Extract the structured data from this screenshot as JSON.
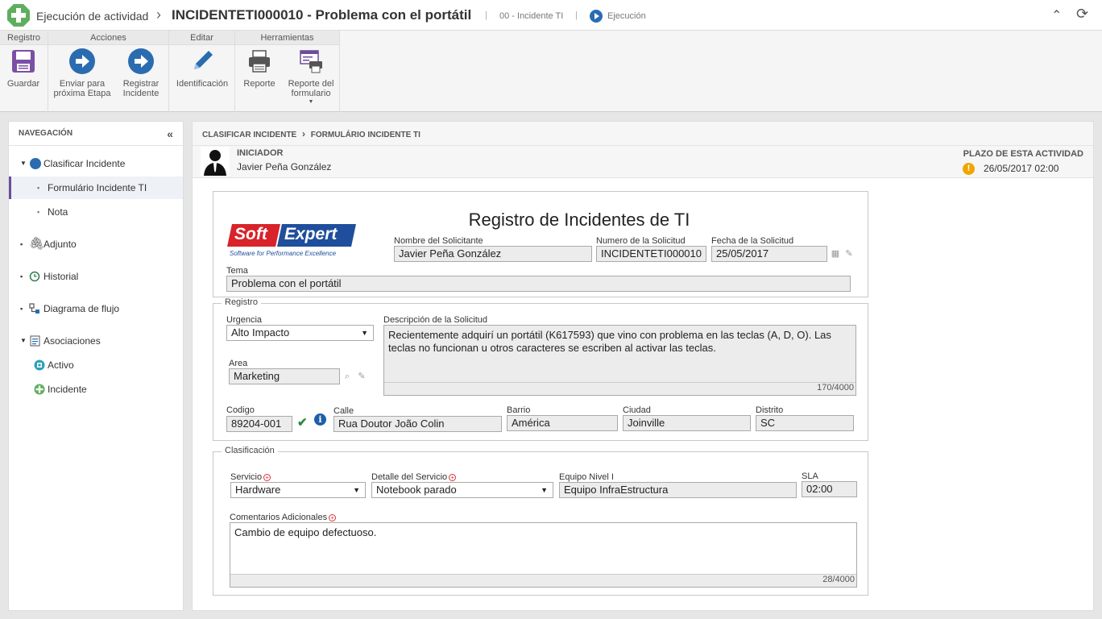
{
  "header": {
    "app_title": "Ejecución de actividad",
    "record_title": "INCIDENTETI000010 - Problema con el portátil",
    "process": "00 - Incidente TI",
    "status": "Ejecución"
  },
  "toolbar": {
    "groups": [
      "Registro",
      "Acciones",
      "Editar",
      "Herramientas"
    ],
    "save": "Guardar",
    "send_l1": "Enviar para",
    "send_l2": "próxima Etapa",
    "register_l1": "Registrar",
    "register_l2": "Incidente",
    "identification": "Identificación",
    "report": "Reporte",
    "form_report_l1": "Reporte del",
    "form_report_l2": "formulario"
  },
  "nav": {
    "title": "NAVEGACIÓN",
    "items": {
      "classify": "Clasificar Incidente",
      "form": "Formulário Incidente TI",
      "note": "Nota",
      "attachment": "Adjunto",
      "history": "Historial",
      "flow": "Diagrama de flujo",
      "associations": "Asociaciones",
      "asset": "Activo",
      "incident": "Incidente"
    }
  },
  "breadcrumb": {
    "step": "CLASIFICAR INCIDENTE",
    "form": "FORMULÁRIO INCIDENTE TI"
  },
  "initiator": {
    "label": "INICIADOR",
    "name": "Javier Peña González",
    "deadline_label": "PLAZO DE ESTA ACTIVIDAD",
    "deadline": "26/05/2017  02:00"
  },
  "form": {
    "title": "Registro de Incidentes de TI",
    "logo_brand": "Soft Expert",
    "logo_soft": "Soft",
    "logo_expert": "Expert",
    "logo_tagline": "Software for Performance Excellence",
    "requester_label": "Nombre del Solicitante",
    "requester": "Javier Peña González",
    "number_label": "Numero de la Solicitud",
    "number": "INCIDENTETI000010",
    "date_label": "Fecha de la Solicitud",
    "date": "25/05/2017",
    "subject_label": "Tema",
    "subject": "Problema con el portátil",
    "registro": {
      "legend": "Registro",
      "urgency_label": "Urgencia",
      "urgency": "Alto Impacto",
      "area_label": "Area",
      "area": "Marketing",
      "desc_label": "Descripción de la Solicitud",
      "desc": "Recientemente adquirí un portátil (K617593) que vino con problema en las teclas (A, D, O). Las teclas no funcionan u otros caracteres se escriben al activar las teclas.",
      "desc_count": "170/4000",
      "code_label": "Codigo",
      "code": "89204-001",
      "street_label": "Calle",
      "street": "Rua Doutor João Colin",
      "district_label": "Barrio",
      "district": "América",
      "city_label": "Ciudad",
      "city": "Joinville",
      "state_label": "Distrito",
      "state": "SC"
    },
    "clasificacion": {
      "legend": "Clasificación",
      "service_label": "Servicio",
      "service": "Hardware",
      "detail_label": "Detalle del Servicio",
      "detail": "Notebook parado",
      "team_label": "Equipo Nivel I",
      "team": "Equipo InfraEstructura",
      "sla_label": "SLA",
      "sla": "02:00",
      "comments_label": "Comentarios Adicionales",
      "comments": "Cambio de equipo defectuoso.",
      "comments_count": "28/4000"
    }
  },
  "colors": {
    "accent": "#2b6cb0",
    "selection": "#6a4d9c",
    "warning": "#f0a500",
    "logo_red": "#d8232a",
    "logo_blue": "#1f4e9c"
  }
}
